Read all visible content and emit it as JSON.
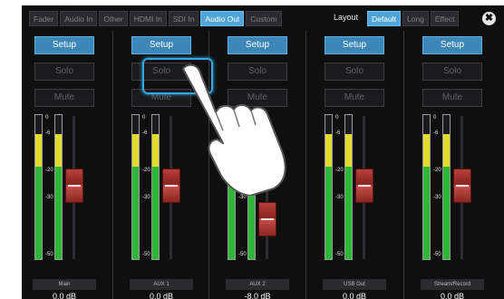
{
  "top_tabs": [
    "Fader",
    "Audio In",
    "Other",
    "HDMI In",
    "SDI In",
    "Audio Out",
    "Custom"
  ],
  "top_tabs_active": 5,
  "layout_label": "Layout",
  "layout_tabs": [
    "Default",
    "Long",
    "Effect"
  ],
  "layout_tabs_active": 0,
  "close_glyph": "✖",
  "meter_ticks": [
    "0",
    "-6",
    "-20",
    "-30",
    "-50"
  ],
  "channels": [
    {
      "setup": "Setup",
      "solo": "Solo",
      "mute": "Mute",
      "name": "Main",
      "level": "0.0 dB"
    },
    {
      "setup": "Setup",
      "solo": "Solo",
      "mute": "Mute",
      "name": "AUX 1",
      "level": "0.0 dB"
    },
    {
      "setup": "Setup",
      "solo": "Solo",
      "mute": "Mute",
      "name": "AUX 2",
      "level": "-8.0 dB"
    },
    {
      "setup": "Setup",
      "solo": "Solo",
      "mute": "Mute",
      "name": "USB Out",
      "level": "0.0 dB"
    },
    {
      "setup": "Setup",
      "solo": "Solo",
      "mute": "Mute",
      "name": "Stream/Record",
      "level": "0.0 dB"
    }
  ],
  "colors": {
    "accent": "#4fa6d6",
    "meter_green": "#2fb838",
    "meter_yellow": "#e3dc2c",
    "fader_knob": "#a8322c",
    "highlight": "#35a7e3"
  },
  "icons": {
    "close": "close-icon",
    "hand": "pointing-hand-icon"
  }
}
